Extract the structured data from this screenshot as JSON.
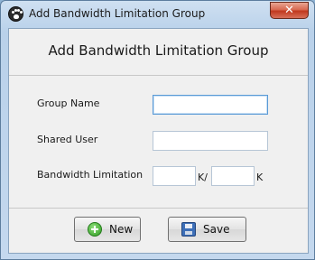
{
  "window": {
    "title": "Add Bandwidth Limitation Group",
    "close_glyph": "✕",
    "icon": "paw-icon"
  },
  "header": {
    "title": "Add Bandwidth Limitation Group"
  },
  "form": {
    "group_name": {
      "label": "Group Name",
      "value": ""
    },
    "shared_user": {
      "label": "Shared User",
      "value": ""
    },
    "bandwidth": {
      "label": "Bandwidth Limitation",
      "download_value": "",
      "download_unit": "K/",
      "upload_value": "",
      "upload_unit": "K"
    }
  },
  "buttons": {
    "new_label": "New",
    "new_icon": "add-icon",
    "save_label": "Save",
    "save_icon": "floppy-disk-icon"
  }
}
